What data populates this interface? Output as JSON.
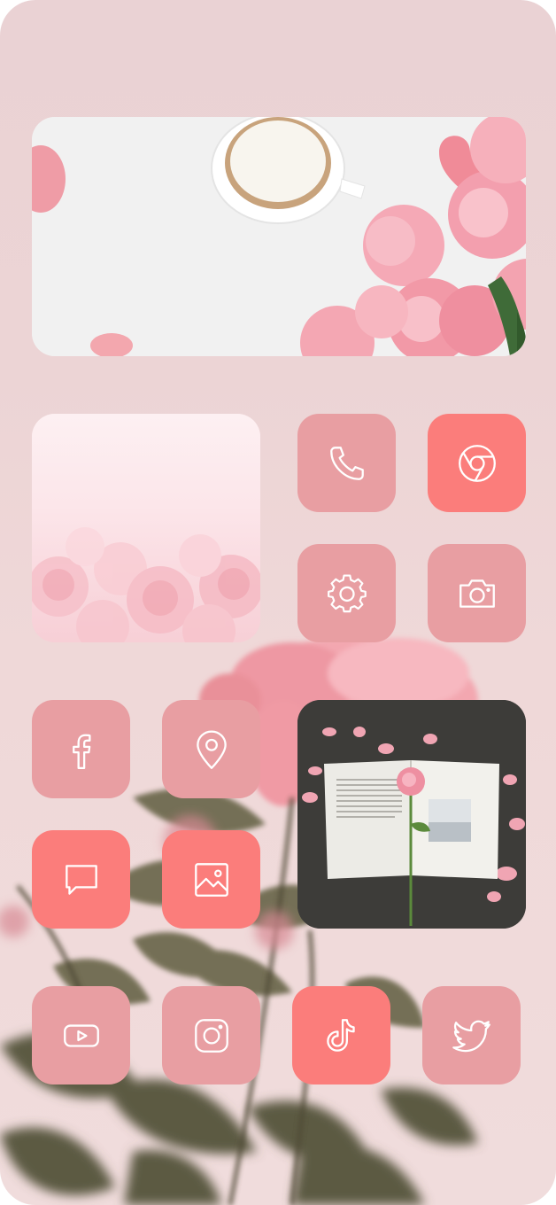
{
  "colors": {
    "tile_muted": "#e89ea2",
    "tile_accent": "#fb7d7b",
    "icon_stroke": "#ffffff",
    "background": "#ecd5d6"
  },
  "widgets": [
    {
      "name": "coffee-roses-photo"
    },
    {
      "name": "pink-roses-photo"
    },
    {
      "name": "book-rose-photo"
    }
  ],
  "apps": [
    {
      "name": "phone",
      "icon": "phone-icon"
    },
    {
      "name": "chrome",
      "icon": "chrome-icon"
    },
    {
      "name": "settings",
      "icon": "gear-icon"
    },
    {
      "name": "camera",
      "icon": "camera-icon"
    },
    {
      "name": "facebook",
      "icon": "facebook-icon"
    },
    {
      "name": "maps",
      "icon": "location-pin-icon"
    },
    {
      "name": "messages",
      "icon": "message-bubble-icon"
    },
    {
      "name": "photos",
      "icon": "image-icon"
    },
    {
      "name": "youtube",
      "icon": "youtube-icon"
    },
    {
      "name": "instagram",
      "icon": "instagram-icon"
    },
    {
      "name": "tiktok",
      "icon": "tiktok-icon"
    },
    {
      "name": "twitter",
      "icon": "twitter-bird-icon"
    }
  ]
}
